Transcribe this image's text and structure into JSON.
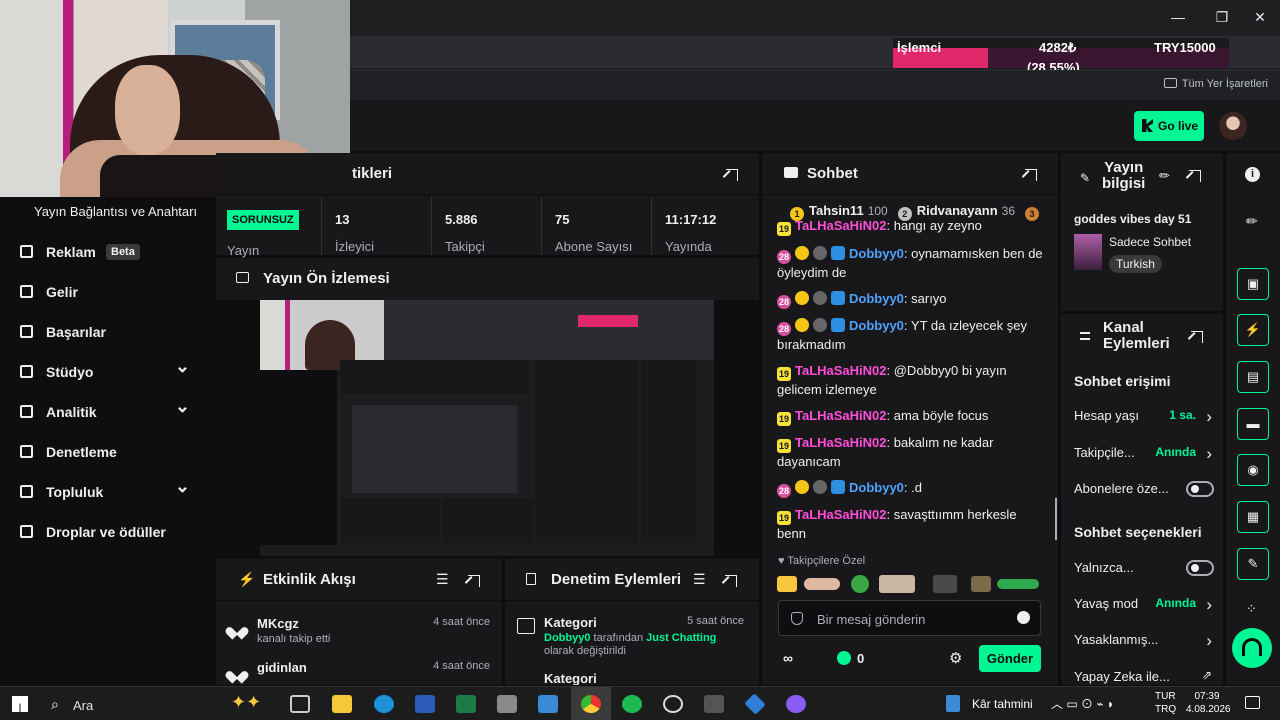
{
  "browser": {
    "ticker": {
      "label": "İşlemci",
      "value": "4282₺",
      "percent": "(28.55%)",
      "target": "TRY15000"
    },
    "bookmarks_all": "Tüm Yer İşaretleri",
    "window_buttons": [
      "—",
      "❐",
      "✕"
    ]
  },
  "topbar": {
    "go_live": "Go live"
  },
  "leftnav": {
    "top_item": "Yayın Bağlantısı ve Anahtarı",
    "items": [
      {
        "label": "Reklam",
        "badge": "Beta",
        "icon": "ad-icon",
        "chevron": false
      },
      {
        "label": "Gelir",
        "icon": "chart-icon",
        "chevron": false
      },
      {
        "label": "Başarılar",
        "icon": "trophy-icon",
        "chevron": false
      },
      {
        "label": "Stüdyo",
        "icon": "studio-icon",
        "chevron": true
      },
      {
        "label": "Analitik",
        "icon": "analytics-icon",
        "chevron": true
      },
      {
        "label": "Denetleme",
        "icon": "wrench-icon",
        "chevron": false
      },
      {
        "label": "Topluluk",
        "icon": "community-icon",
        "chevron": true
      },
      {
        "label": "Droplar ve ödüller",
        "icon": "gift-icon",
        "chevron": false
      }
    ]
  },
  "stats": {
    "title": "tikleri",
    "status": "SORUNSUZ",
    "status_label": "Yayın",
    "columns": [
      {
        "value": "13",
        "label": "İzleyici"
      },
      {
        "value": "5.886",
        "label": "Takipçi"
      },
      {
        "value": "75",
        "label": "Abone Sayısı"
      },
      {
        "value": "11:17:12",
        "label": "Yayında"
      }
    ]
  },
  "preview": {
    "title": "Yayın Ön İzlemesi"
  },
  "activity": {
    "title": "Etkinlik Akışı",
    "items": [
      {
        "name": "MKcgz",
        "sub": "kanalı takip etti",
        "time": "4 saat önce"
      },
      {
        "name": "gidinlan",
        "sub": "",
        "time": "4 saat önce"
      }
    ]
  },
  "moderation": {
    "title": "Denetim Eylemleri",
    "items": [
      {
        "title": "Kategori",
        "time": "5 saat önce",
        "by": "Dobbyy0",
        "text1": " tarafından ",
        "category": "Just Chatting",
        "text2": " olarak değiştirildi"
      },
      {
        "title": "Kategori",
        "time": "",
        "by": "",
        "text1": "",
        "category": "",
        "text2": ""
      }
    ]
  },
  "chat": {
    "title": "Sohbet",
    "leaderboard": [
      {
        "rank": "1",
        "name": "Tahsin11",
        "score": "100",
        "color": "#f5c518"
      },
      {
        "rank": "2",
        "name": "Ridvanayann",
        "score": "36",
        "color": "#c0c0c0"
      },
      {
        "rank": "3",
        "name": "",
        "score": "",
        "color": "#cd7f32"
      }
    ],
    "messages": [
      {
        "user": "TaLHaSaHiN02",
        "text": ": hangı ay zeyno",
        "months": "19",
        "style": "pink"
      },
      {
        "user": "Dobbyy0",
        "text": ": oynamamısken ben de öyleydim de",
        "months": "28",
        "style": "blue"
      },
      {
        "user": "Dobbyy0",
        "text": ": sarıyo",
        "months": "28",
        "style": "blue"
      },
      {
        "user": "Dobbyy0",
        "text": ": YT da ızleyecek şey bırakmadım",
        "months": "28",
        "style": "blue"
      },
      {
        "user": "TaLHaSaHiN02",
        "text": ": @Dobbyy0 bi yayın gelicem izlemeye",
        "months": "19",
        "style": "pink"
      },
      {
        "user": "TaLHaSaHiN02",
        "text": ": ama böyle focus",
        "months": "19",
        "style": "pink"
      },
      {
        "user": "TaLHaSaHiN02",
        "text": ": bakalım ne kadar dayanıcam",
        "months": "19",
        "style": "pink"
      },
      {
        "user": "Dobbyy0",
        "text": ": .d",
        "months": "28",
        "style": "blue"
      },
      {
        "user": "TaLHaSaHiN02",
        "text": ": savaşttıımm herkesle benn",
        "months": "19",
        "style": "pink"
      }
    ],
    "followers_only": "Takipçilere Özel",
    "placeholder": "Bir mesaj gönderin",
    "points": "0",
    "send": "Gönder"
  },
  "info": {
    "title_line1": "Yayın",
    "title_line2": "bilgisi",
    "stream_title": "goddes vibes day 51",
    "category": "Sadece Sohbet",
    "tag": "Turkish"
  },
  "channel_actions": {
    "title_line1": "Kanal",
    "title_line2": "Eylemleri",
    "chat_access": "Sohbet erişimi",
    "rows1": [
      {
        "label": "Hesap yaşı",
        "value": "1 sa.",
        "kind": "arrow"
      },
      {
        "label": "Takipçile...",
        "value": "Anında",
        "kind": "arrow"
      },
      {
        "label": "Abonelere öze...",
        "value": "",
        "kind": "toggle"
      }
    ],
    "chat_options": "Sohbet seçenekleri",
    "rows2": [
      {
        "label": "Yalnızca...",
        "value": "",
        "kind": "toggle"
      },
      {
        "label": "Yavaş mod",
        "value": "Anında",
        "kind": "arrow"
      },
      {
        "label": "Yasaklanmış...",
        "value": "",
        "kind": "arrow"
      },
      {
        "label": "Yapay Zeka ile...",
        "value": "",
        "kind": "pop"
      }
    ]
  },
  "taskbar": {
    "search": "Ara",
    "weather": "Kâr tahmini",
    "lang": "TUR",
    "lang2": "TRQ",
    "time": "07:39",
    "date": "4.08.2026"
  },
  "colors": {
    "accent": "#00f593",
    "twitch_bg": "#0e0e10",
    "panel": "#18181b",
    "pink_user": "#ff4fd8",
    "blue_user": "#4ea3ff"
  }
}
